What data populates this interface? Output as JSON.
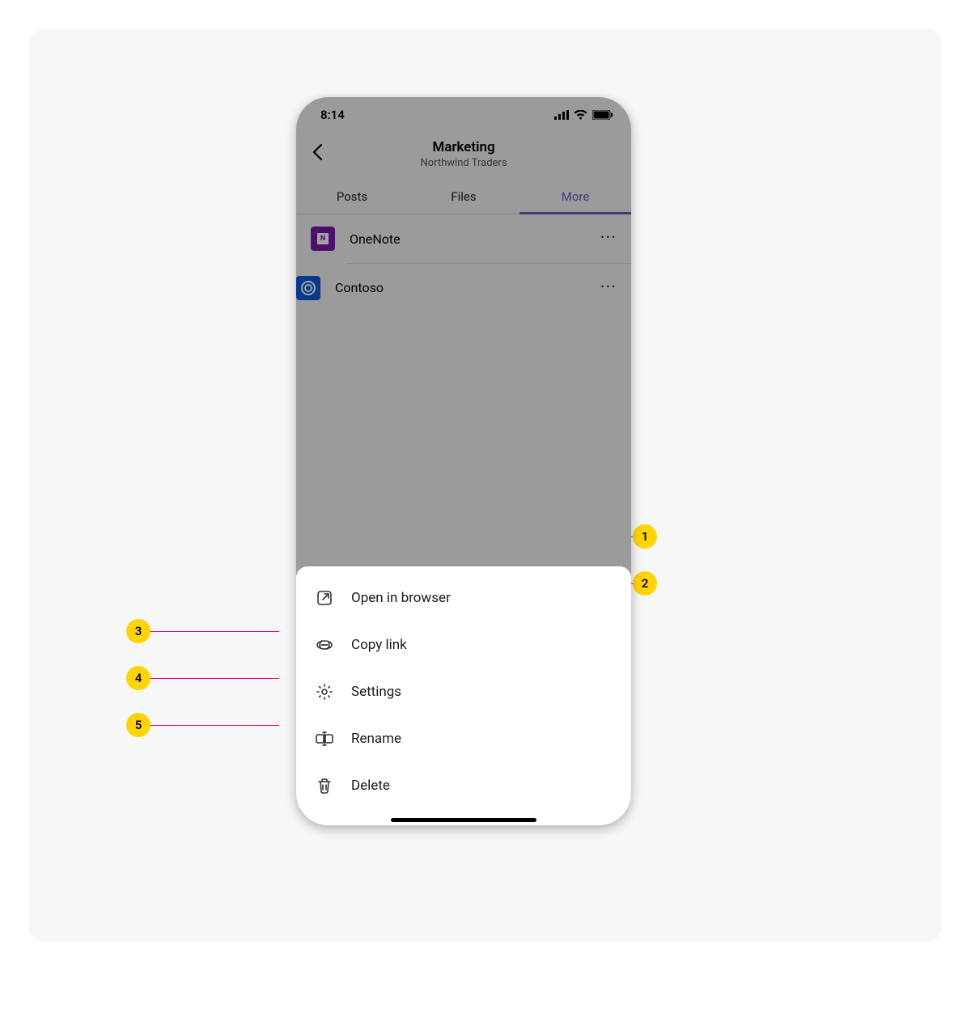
{
  "statusbar": {
    "time": "8:14"
  },
  "header": {
    "title": "Marketing",
    "subtitle": "Northwind Traders"
  },
  "tabs": {
    "posts": "Posts",
    "files": "Files",
    "more": "More"
  },
  "apps": {
    "items": [
      {
        "label": "OneNote"
      },
      {
        "label": "Contoso"
      }
    ]
  },
  "sheet": {
    "items": [
      {
        "label": "Open in browser"
      },
      {
        "label": "Copy link"
      },
      {
        "label": "Settings"
      },
      {
        "label": "Rename"
      },
      {
        "label": "Delete"
      }
    ]
  },
  "callouts": {
    "n1": "1",
    "n2": "2",
    "n3": "3",
    "n4": "4",
    "n5": "5"
  }
}
